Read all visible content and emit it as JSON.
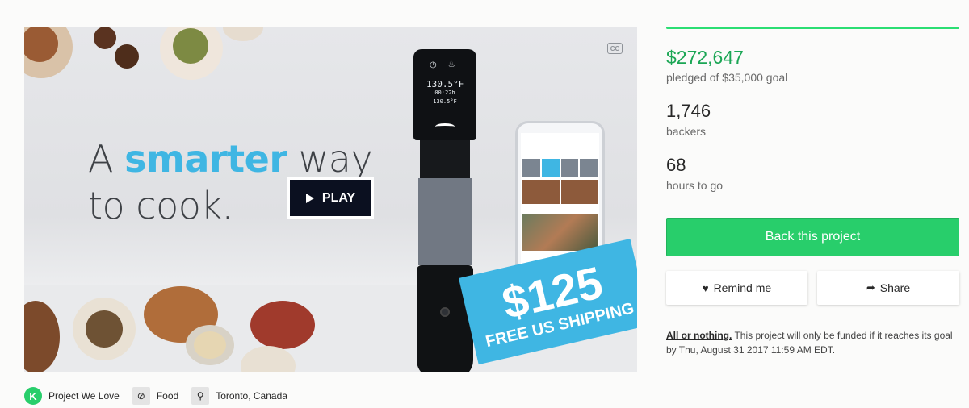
{
  "video": {
    "headline_line1_pre": "A ",
    "headline_accent": "smarter",
    "headline_line1_post": " way",
    "headline_line2": "to cook.",
    "play_label": "PLAY",
    "cc_label": "CC",
    "device_screen_line1": "130.5°F",
    "device_screen_line2": "00:22h 130.5°F",
    "badge_price": "$125",
    "badge_shipping": "FREE US SHIPPING",
    "accent_color": "#3fb6e3"
  },
  "stats": {
    "pledged_amount": "$272,647",
    "pledged_label": "pledged of $35,000 goal",
    "backers_count": "1,746",
    "backers_label": "backers",
    "hours_count": "68",
    "hours_label": "hours to go",
    "progress_fraction": 1.0,
    "progress_color": "#2bde73"
  },
  "actions": {
    "back_label": "Back this project",
    "remind_label": "Remind me",
    "share_label": "Share",
    "back_color": "#28ce6b"
  },
  "terms": {
    "all_or_nothing": "All or nothing.",
    "text": " This project will only be funded if it reaches its goal by Thu, August 31 2017 11:59 AM EDT."
  },
  "tags": [
    {
      "label": "Project We Love",
      "icon": "kickstarter-k-icon"
    },
    {
      "label": "Food",
      "icon": "compass-icon"
    },
    {
      "label": "Toronto, Canada",
      "icon": "location-pin-icon"
    }
  ]
}
